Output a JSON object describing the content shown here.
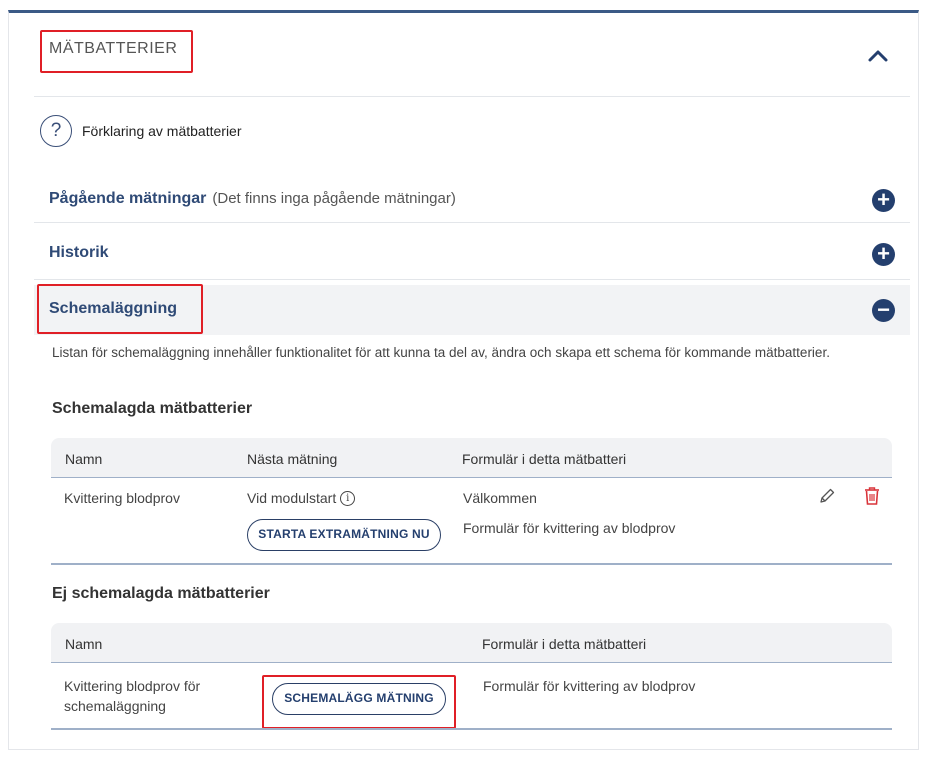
{
  "panel": {
    "title": "MÄTBATTERIER"
  },
  "help": {
    "label": "Förklaring av mätbatterier"
  },
  "sections": {
    "ongoing": {
      "title": "Pågående mätningar",
      "note": "(Det finns inga pågående mätningar)"
    },
    "history": {
      "title": "Historik"
    },
    "scheduling": {
      "title": "Schemaläggning",
      "description": "Listan för schemaläggning innehåller funktionalitet för att kunna ta del av, ändra och skapa ett schema för kommande mätbatterier."
    }
  },
  "scheduled": {
    "heading": "Schemalagda mätbatterier",
    "columns": [
      "Namn",
      "Nästa mätning",
      "Formulär i detta mätbatteri"
    ],
    "row": {
      "name": "Kvittering blodprov",
      "next": "Vid modulstart",
      "info_glyph": "i",
      "button": "STARTA EXTRAMÄTNING NU",
      "forms": [
        "Välkommen",
        "Formulär för kvittering av blodprov"
      ]
    }
  },
  "unscheduled": {
    "heading": "Ej schemalagda mätbatterier",
    "columns": [
      "Namn",
      "Formulär i detta mätbatteri"
    ],
    "row": {
      "name_line1": "Kvittering blodprov för",
      "name_line2": "schemaläggning",
      "button": "SCHEMALÄGG MÄTNING",
      "form": "Formulär för kvittering av blodprov"
    }
  },
  "icons": {
    "collapse": "chevron-up-icon",
    "help": "question-circle-icon",
    "expand": "plus-circle-icon",
    "collapse_section": "minus-circle-icon",
    "edit": "pencil-icon",
    "delete": "trash-icon"
  },
  "colors": {
    "accent": "#243f6e",
    "highlight": "#e01f26",
    "delete": "#d9343a"
  }
}
